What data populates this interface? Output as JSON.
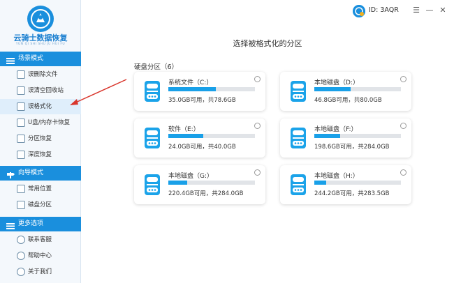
{
  "app": {
    "name": "云骑士数据恢复",
    "subtitle": "YUN QI SHI SHU JU HUI FU",
    "user_id": "ID: 3AQR"
  },
  "window_controls": {
    "menu": "☰",
    "minimize": "—",
    "close": "✕"
  },
  "sidebar": {
    "sections": [
      {
        "title": "场景模式",
        "items": [
          {
            "label": "误删除文件",
            "icon": "file-delete-icon"
          },
          {
            "label": "误清空回收站",
            "icon": "recycle-bin-icon"
          },
          {
            "label": "误格式化",
            "icon": "disk-format-icon",
            "active": true
          },
          {
            "label": "U盘/内存卡恢复",
            "icon": "usb-drive-icon"
          },
          {
            "label": "分区恢复",
            "icon": "partition-icon"
          },
          {
            "label": "深度恢复",
            "icon": "deep-scan-icon"
          }
        ]
      },
      {
        "title": "向导模式",
        "items": [
          {
            "label": "常用位置",
            "icon": "common-location-icon"
          },
          {
            "label": "磁盘分区",
            "icon": "disk-partition-icon"
          }
        ]
      },
      {
        "title": "更多选项",
        "items": [
          {
            "label": "联系客服",
            "icon": "customer-service-icon"
          },
          {
            "label": "帮助中心",
            "icon": "help-icon"
          },
          {
            "label": "关于我们",
            "icon": "about-icon"
          }
        ]
      }
    ]
  },
  "main": {
    "title": "选择被格式化的分区",
    "group_label": "硬盘分区（6）",
    "partitions": [
      {
        "name": "系统文件（C:）",
        "info": "35.0GB可用，共78.6GB",
        "used_fraction": 0.55
      },
      {
        "name": "本地磁盘（D:）",
        "info": "46.8GB可用，共80.0GB",
        "used_fraction": 0.42
      },
      {
        "name": "软件（E:）",
        "info": "24.0GB可用，共40.0GB",
        "used_fraction": 0.4
      },
      {
        "name": "本地磁盘（F:）",
        "info": "198.6GB可用，共284.0GB",
        "used_fraction": 0.3
      },
      {
        "name": "本地磁盘（G:）",
        "info": "220.4GB可用，共284.0GB",
        "used_fraction": 0.22
      },
      {
        "name": "本地磁盘（H:）",
        "info": "244.2GB可用，共283.5GB",
        "used_fraction": 0.14
      }
    ]
  },
  "colors": {
    "accent": "#1a8fdd",
    "bar_fill": "#19a0e8",
    "bar_bg": "#e1e4e8",
    "annotation_arrow": "#d9352b"
  }
}
